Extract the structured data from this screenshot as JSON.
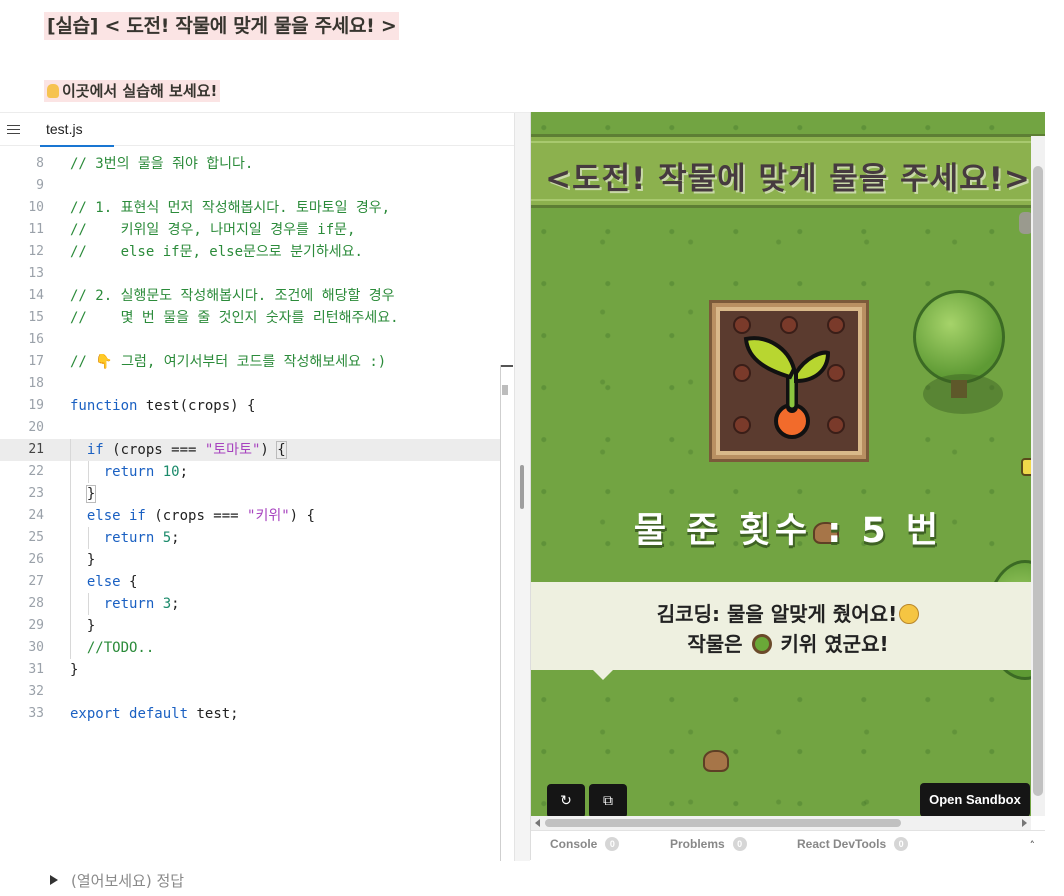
{
  "lesson": {
    "title": "[실습] < 도전! 작물에 맞게 물을 주세요! >",
    "hint": "이곳에서 실습해 보세요!",
    "hint_icon": "pointing-down-finger-emoji"
  },
  "editor": {
    "file_tab": "test.js",
    "active_line": 21,
    "lines": [
      {
        "n": "8",
        "html": "<span class='c-comment'>// 3번의 물을 줘야 합니다.</span>"
      },
      {
        "n": "9",
        "html": ""
      },
      {
        "n": "10",
        "html": "<span class='c-comment'>// 1. 표현식 먼저 작성해봅시다. 토마토일 경우,</span>"
      },
      {
        "n": "11",
        "html": "<span class='c-comment'>//    키위일 경우, 나머지일 경우를 if문,</span>"
      },
      {
        "n": "12",
        "html": "<span class='c-comment'>//    else if문, else문으로 분기하세요.</span>"
      },
      {
        "n": "13",
        "html": ""
      },
      {
        "n": "14",
        "html": "<span class='c-comment'>// 2. 실행문도 작성해봅시다. 조건에 해당할 경우</span>"
      },
      {
        "n": "15",
        "html": "<span class='c-comment'>//    몇 번 물을 줄 것인지 숫자를 리턴해주세요.</span>"
      },
      {
        "n": "16",
        "html": ""
      },
      {
        "n": "17",
        "html": "<span class='c-comment'>// 👇 그럼, 여기서부터 코드를 작성해보세요 :)</span>"
      },
      {
        "n": "18",
        "html": ""
      },
      {
        "n": "19",
        "html": "<span class='c-kw'>function</span> test(crops) {"
      },
      {
        "n": "20",
        "html": ""
      },
      {
        "n": "21",
        "html": "  <span class='c-kw'>if</span> (crops === <span class='c-str'>\"토마토\"</span>) <span class='c-br'>{</span>"
      },
      {
        "n": "22",
        "html": "    <span class='c-kw'>return</span> <span class='c-num'>10</span>;"
      },
      {
        "n": "23",
        "html": "  <span class='c-br'>}</span>"
      },
      {
        "n": "24",
        "html": "  <span class='c-kw'>else if</span> (crops === <span class='c-str'>\"키위\"</span>) {"
      },
      {
        "n": "25",
        "html": "    <span class='c-kw'>return</span> <span class='c-num'>5</span>;"
      },
      {
        "n": "26",
        "html": "  }"
      },
      {
        "n": "27",
        "html": "  <span class='c-kw'>else</span> {"
      },
      {
        "n": "28",
        "html": "    <span class='c-kw'>return</span> <span class='c-num'>3</span>;"
      },
      {
        "n": "29",
        "html": "  }"
      },
      {
        "n": "30",
        "html": "  <span class='c-comment'>//TODO..</span>"
      },
      {
        "n": "31",
        "html": "}"
      },
      {
        "n": "32",
        "html": ""
      },
      {
        "n": "33",
        "html": "<span class='c-kw'>export</span> <span class='c-kw'>default</span> test;"
      }
    ]
  },
  "preview": {
    "banner": "<도전! 작물에 맞게 물을 주세요!>",
    "watered_count": "물 준 횟수 : 5 번",
    "dialog_line1": "김코딩: 물을 알맞게 줬어요!",
    "dialog_line2_pre": "작물은",
    "dialog_line2_post": "키위 였군요!",
    "open_sandbox": "Open Sandbox",
    "refresh_icon": "↻",
    "external_icon": "⧉",
    "devtabs": [
      {
        "label": "Console",
        "count": "0"
      },
      {
        "label": "Problems",
        "count": "0"
      },
      {
        "label": "React DevTools",
        "count": "0"
      }
    ],
    "collapse_icon": "˄"
  },
  "answer_toggle": "(열어보세요) 정답",
  "colors": {
    "highlight_bg": "#fbe4e4",
    "grass": "#72a442",
    "comment": "#2b8b3a",
    "keyword": "#1a60c2",
    "string": "#a743bf"
  }
}
